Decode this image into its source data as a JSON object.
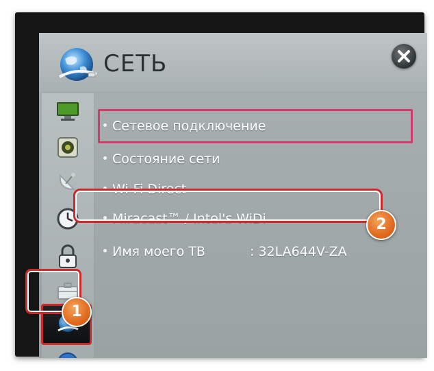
{
  "header": {
    "title": "СЕТЬ"
  },
  "menu": {
    "items": [
      {
        "label": "Сетевое подключение"
      },
      {
        "label": "Состояние сети"
      },
      {
        "label": "Wi-Fi Direct"
      },
      {
        "label": "Miracast™ / Intel's WiDi"
      },
      {
        "label": "Имя моего ТВ"
      }
    ],
    "tv_name_value": ":  32LA644V-ZA"
  },
  "callouts": {
    "badge_1": "1",
    "badge_2": "2"
  },
  "sidebar": {
    "items": [
      {
        "icon": "monitor-icon"
      },
      {
        "icon": "speaker-icon"
      },
      {
        "icon": "satellite-dish-icon"
      },
      {
        "icon": "clock-icon"
      },
      {
        "icon": "lock-icon"
      },
      {
        "icon": "briefcase-icon"
      },
      {
        "icon": "network-globe-icon",
        "selected": true
      },
      {
        "icon": "help-icon"
      }
    ]
  },
  "colors": {
    "highlight": "#d23a6a",
    "callout": "#cc2a2a",
    "badge": "#e06a1e"
  }
}
